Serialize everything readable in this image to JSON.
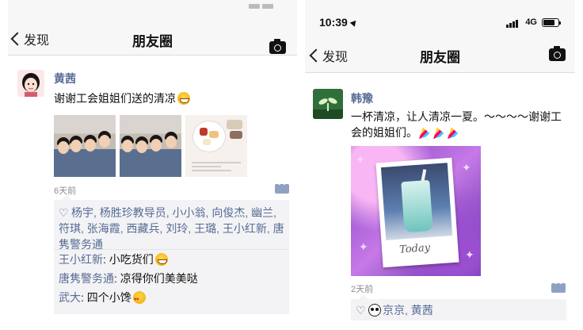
{
  "left": {
    "nav": {
      "back_label": "发现",
      "title": "朋友圈"
    },
    "post": {
      "user": "黄茜",
      "text": "谢谢工会姐姐们送的清凉",
      "time": "6天前",
      "likes": "杨宇, 杨胜珍教导员, 小小翁, 向俊杰, 幽兰, 符琪, 张海霞, 西藏兵, 刘玲, 王璐, 王小红新, 唐隽警务通",
      "comments": [
        {
          "user": "王小红新",
          "text": ": 小吃货们",
          "emoji": "grin"
        },
        {
          "user": "唐隽警务通",
          "text": ": 凉得你们美美哒",
          "emoji": ""
        },
        {
          "user": "武大",
          "text": ": 四个小馋",
          "emoji": "love"
        }
      ]
    }
  },
  "right": {
    "status": {
      "time": "10:39",
      "network": "4G"
    },
    "nav": {
      "back_label": "发现",
      "title": "朋友圈"
    },
    "post": {
      "user": "韩豫",
      "text": "一杯清凉，让人清凉一夏。～～～～谢谢工会的姐姐们。",
      "image_caption": "Today",
      "time": "2天前",
      "likes": "京京, 黄茜"
    }
  },
  "colors": {
    "link": "#576b95",
    "bar": "#f7f7f7",
    "comment_bg": "#f3f3f5"
  }
}
